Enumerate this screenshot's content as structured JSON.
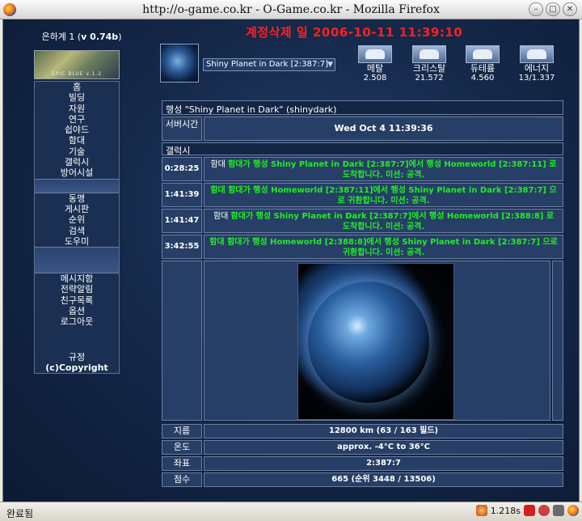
{
  "window": {
    "title": "http://o-game.co.kr - O-Game.co.kr - Mozilla Firefox"
  },
  "left": {
    "universe_label": "은하계 1 (",
    "version": "v 0.74b",
    "universe_close": ")",
    "logo_text": "EPIC BLUE v.1.2",
    "menu_group_1": [
      "홈",
      "빌딩",
      "자원",
      "연구",
      "쉽야드",
      "함대",
      "기술",
      "갤럭시",
      "방어시설"
    ],
    "menu_group_2": [
      "동맹",
      "게시판",
      "순위",
      "검색",
      "도우미"
    ],
    "menu_group_3": [
      "메시지함",
      "전략알림",
      "친구목록",
      "옵션",
      "로그아웃"
    ],
    "menu_group_4": [
      "규정",
      "(c)Copyright"
    ]
  },
  "header": {
    "delete_notice": "계정삭제 일 2006-10-11 11:39:10",
    "planet_select": "Shiny Planet in Dark [2:387:7]"
  },
  "resources": [
    {
      "name": "메탈",
      "value": "2.508",
      "icon": "metal-icon"
    },
    {
      "name": "크리스탈",
      "value": "21.572",
      "icon": "crystal-icon"
    },
    {
      "name": "듀테륨",
      "value": "4.560",
      "icon": "deuterium-icon"
    },
    {
      "name": "에너지",
      "value": "13/1.337",
      "icon": "energy-icon"
    }
  ],
  "overview": {
    "planet_header": "행성 \"Shiny Planet in Dark\" (shinydark)",
    "server_time_label": "서버시간",
    "server_time_value": "Wed Oct 4 11:39:36",
    "events_label": "갤럭시",
    "fleets": [
      {
        "time": "0:28:25",
        "prefix": "함대 ",
        "text": "함대가 행성 Shiny Planet in Dark [2:387:7]에서 행성 Homeworld [2:387:11] 로 도착합니다. 미션: 공격."
      },
      {
        "time": "1:41:39",
        "prefix": "",
        "text": "함대 함대가 행성 Homeworld [2:387:11]에서 행성 Shiny Planet in Dark [2:387:7] 으로 귀환합니다. 미션: 공격."
      },
      {
        "time": "1:41:47",
        "prefix": "함대 ",
        "text": "함대가 행성 Shiny Planet in Dark [2:387:7]에서 행성 Homeworld [2:388:8] 로 도착합니다. 미션: 공격."
      },
      {
        "time": "3:42:55",
        "prefix": "",
        "text": "함대 함대가 행성 Homeworld [2:388:8]에서 행성 Shiny Planet in Dark [2:387:7] 으로 귀환합니다. 미션: 공격."
      }
    ],
    "stats": [
      {
        "label": "지름",
        "value": "12800 km (63 / 163 필드)"
      },
      {
        "label": "온도",
        "value": "approx. -4°C to 36°C"
      },
      {
        "label": "좌표",
        "value": "2:387:7"
      },
      {
        "label": "점수",
        "value": "665 (순위 3448 / 13506)"
      }
    ]
  },
  "status": {
    "text": "완료됨",
    "timer": "1.218s"
  }
}
